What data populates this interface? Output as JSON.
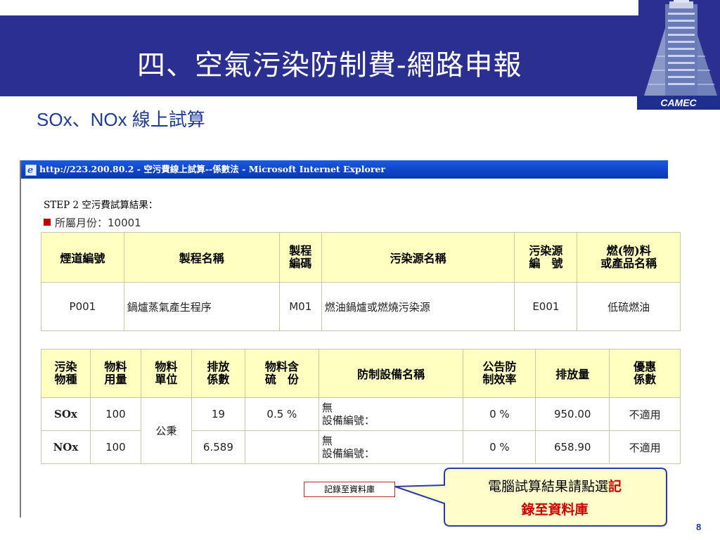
{
  "slide": {
    "title": "四、空氣污染防制費-網路申報",
    "subtitle": "SOx、NOx 線上試算",
    "logo_text": "CAMEC",
    "page_number": "8"
  },
  "browser": {
    "window_title": "http://223.200.80.2 - 空污費線上試算--係數法 - Microsoft Internet Explorer"
  },
  "content": {
    "step_heading": "STEP 2 空污費試算結果：",
    "month_label": "所屬月份：10001"
  },
  "table1": {
    "headers": [
      "煙道編號",
      "製程名稱",
      "製程\n編碼",
      "污染源名稱",
      "污染源\n編　號",
      "燃(物)料\n或產品名稱"
    ],
    "row": [
      "P001",
      "鍋爐蒸氣產生程序",
      "M01",
      "燃油鍋爐或燃燒污染源",
      "E001",
      "低硫燃油"
    ]
  },
  "table2": {
    "headers": [
      "污染\n物種",
      "物料\n用量",
      "物料\n單位",
      "排放\n係數",
      "物料含\n硫　份",
      "防制設備名稱",
      "公告防\n制效率",
      "排放量",
      "優惠\n係數"
    ],
    "unit_shared": "公秉",
    "rows": [
      {
        "species": "SOx",
        "usage": "100",
        "factor": "19",
        "sulfur": "0.5 %",
        "device_line1": "無",
        "device_line2": "設備編號：",
        "efficiency": "0 %",
        "emission": "950.00",
        "discount": "不適用"
      },
      {
        "species": "NOx",
        "usage": "100",
        "factor": "6.589",
        "sulfur": "",
        "device_line1": "無",
        "device_line2": "設備編號：",
        "efficiency": "0 %",
        "emission": "658.90",
        "discount": "不適用"
      }
    ]
  },
  "actions": {
    "save_label": "記錄至資料庫"
  },
  "callout": {
    "text_plain": "電腦試算結果請點選",
    "text_highlight_1": "記",
    "text_highlight_2": "錄至資料庫"
  },
  "colors": {
    "title_bar": "#2b2f8f",
    "subtitle": "#1e3b96",
    "table_header_bg": "#ffffc0",
    "callout_bg": "#ffffcc",
    "highlight": "#cc0000"
  }
}
